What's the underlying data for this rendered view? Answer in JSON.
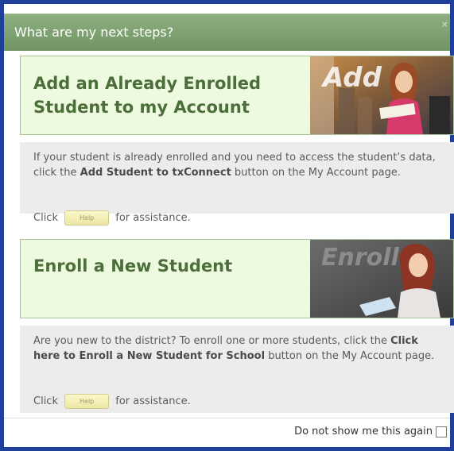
{
  "dialog": {
    "title": "What are my next steps?",
    "close": "×"
  },
  "card1": {
    "heading_line1": "Add an Already Enrolled",
    "heading_line2": "Student to my Account",
    "image_word": "Add",
    "text_pre": "If your student is already enrolled and you need to access the student’s data, click the ",
    "text_bold": "Add Student to txConnect",
    "text_post": " button on the My Account page.",
    "click_label": "Click",
    "help_label": "Help",
    "assist_label": "for assistance."
  },
  "card2": {
    "heading": "Enroll a New Student",
    "image_word": "Enroll",
    "text_pre": "Are you new to the district? To enroll one or more students, click the ",
    "text_bold": "Click here to Enroll a New Student for School",
    "text_post": " button on the My Account page.",
    "click_label": "Click",
    "help_label": "Help",
    "assist_label": "for assistance."
  },
  "footer": {
    "checkbox_label": "Do not show me this again",
    "checked": false
  }
}
